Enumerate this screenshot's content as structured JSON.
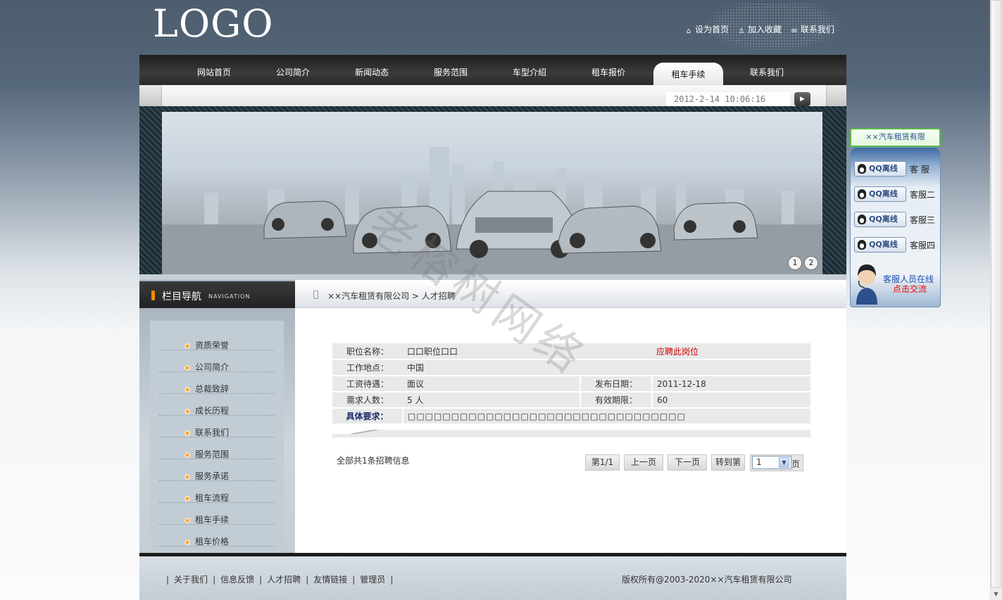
{
  "header": {
    "logo": "LOGO",
    "links": [
      {
        "icon": "home-icon",
        "label": "设为首页"
      },
      {
        "icon": "bookmark-icon",
        "label": "加入收藏"
      },
      {
        "icon": "mail-icon",
        "label": "联系我们"
      }
    ]
  },
  "nav": {
    "items": [
      "网站首页",
      "公司简介",
      "新闻动态",
      "服务范围",
      "车型介绍",
      "租车报价",
      "租车手续",
      "联系我们"
    ],
    "active": "租车手续"
  },
  "datetime": "2012-2-14 10:06:16",
  "banner": {
    "pages": [
      "1",
      "2"
    ]
  },
  "sidebar": {
    "title": "栏目导航",
    "title_en": "NAVIGATION",
    "items": [
      "资质荣誉",
      "公司简介",
      "总裁致辞",
      "成长历程",
      "联系我们",
      "服务范围",
      "服务承诺",
      "租车流程",
      "租车手续",
      "租车价格"
    ]
  },
  "breadcrumb": "××汽车租赁有限公司 > 人才招聘",
  "job": {
    "title_label": "职位名称：",
    "title_value": "口口职位口口",
    "apply": "应聘此岗位",
    "location_label": "工作地点：",
    "location_value": "中国",
    "salary_label": "工资待遇：",
    "salary_value": "面议",
    "date_label": "发布日期：",
    "date_value": "2011-12-18",
    "count_label": "需求人数：",
    "count_value": "5 人",
    "valid_label": "有效期限：",
    "valid_value": "60",
    "req_label": "具体要求：",
    "req_value": "□□□□□□□□□□□□□□□□□□□□□□□□□□□□□□□□"
  },
  "pager": {
    "total": "全部共1条招聘信息",
    "page_info": "第1/1",
    "prev": "上一页",
    "next": "下一页",
    "goto": "转到第",
    "selected": "1",
    "unit": "页"
  },
  "footer": {
    "links": [
      "关于我们",
      "信息反馈",
      "人才招聘",
      "友情链接",
      "管理员"
    ],
    "separator": "|",
    "copyright": "版权所有@2003-2020××汽车租赁有限公司"
  },
  "watermark": "老榕树网络",
  "qq": {
    "title": "××汽车租赁有限",
    "button_label": "QQ离线",
    "agents": [
      "客 服",
      "客服二",
      "客服三",
      "客服四"
    ],
    "online_text": "客服人员在线",
    "chat_text": "点击交流"
  },
  "colors": {
    "accent": "#ff8a00",
    "apply": "#cc0000",
    "qq_border": "#5bb74a"
  }
}
